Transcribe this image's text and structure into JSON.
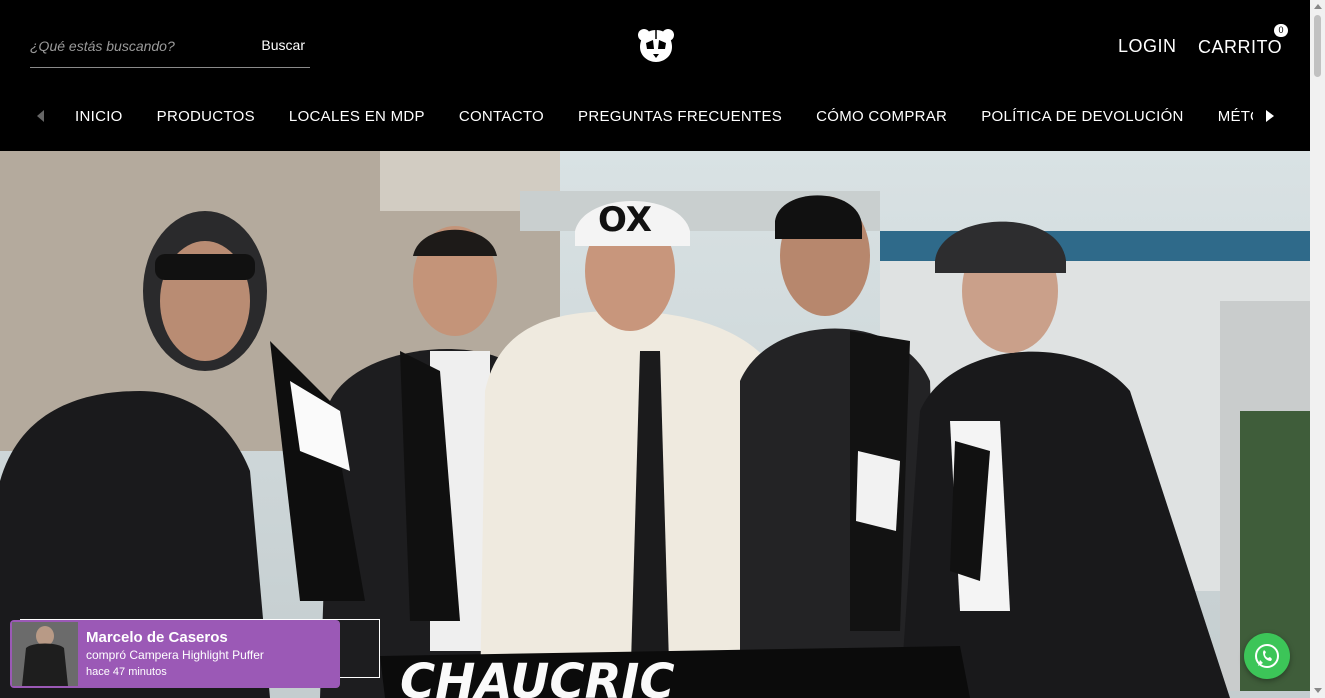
{
  "header": {
    "search": {
      "placeholder": "¿Qué estás buscando?",
      "value": "",
      "button_label": "Buscar"
    },
    "logo_icon": "panda-logo-icon",
    "login_label": "LOGIN",
    "cart_label": "CARRITO",
    "cart_count": "0"
  },
  "nav": {
    "left_arrow_icon": "chevron-left-icon",
    "right_arrow_icon": "chevron-right-icon",
    "items": [
      {
        "label": "INICIO"
      },
      {
        "label": "PRODUCTOS"
      },
      {
        "label": "LOCALES EN MDP"
      },
      {
        "label": "CONTACTO"
      },
      {
        "label": "PREGUNTAS FRECUENTES"
      },
      {
        "label": "CÓMO COMPRAR"
      },
      {
        "label": "POLÍTICA DE DEVOLUCIÓN"
      },
      {
        "label": "MÉTODOS DE ENVÍO"
      }
    ]
  },
  "hero": {
    "image": "group-photo-five-men-scarves"
  },
  "notification": {
    "name": "Marcelo de Caseros",
    "message": "compró Campera Highlight Puffer",
    "time": "hace 47 minutos"
  },
  "whatsapp_icon": "whatsapp-icon",
  "colors": {
    "header_bg": "#000000",
    "notification_bg": "#9b59b6",
    "whatsapp": "#3cc558"
  }
}
